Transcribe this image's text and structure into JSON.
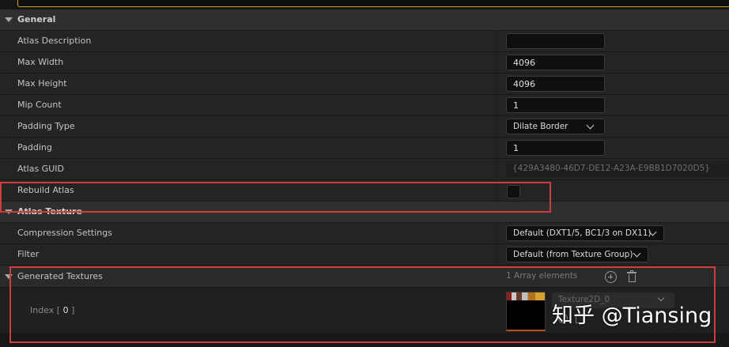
{
  "categories": {
    "general": "General",
    "atlas_texture": "Atlas Texture"
  },
  "rows": {
    "atlas_description": {
      "label": "Atlas Description",
      "value": ""
    },
    "max_width": {
      "label": "Max Width",
      "value": "4096"
    },
    "max_height": {
      "label": "Max Height",
      "value": "4096"
    },
    "mip_count": {
      "label": "Mip Count",
      "value": "1"
    },
    "padding_type": {
      "label": "Padding Type",
      "value": "Dilate Border"
    },
    "padding": {
      "label": "Padding",
      "value": "1"
    },
    "atlas_guid": {
      "label": "Atlas GUID",
      "value": "{429A3480-46D7-DE12-A23A-E9BB1D7020D5}"
    },
    "rebuild_atlas": {
      "label": "Rebuild Atlas",
      "checked": false
    },
    "compression_settings": {
      "label": "Compression Settings",
      "value": "Default (DXT1/5, BC1/3 on DX11)"
    },
    "filter": {
      "label": "Filter",
      "value": "Default (from Texture Group)"
    }
  },
  "generated_textures": {
    "label": "Generated Textures",
    "count_text": "1 Array elements",
    "element": {
      "index_prefix": "Index [",
      "index": "0",
      "index_suffix": "]",
      "asset_name": "Texture2D_0"
    }
  },
  "watermark": "知乎 @Tiansing",
  "colors": {
    "highlight_box": "#d23b3b",
    "search_border": "#c8a030",
    "panel_bg": "#242424",
    "category_bg": "#2f2f2f"
  }
}
